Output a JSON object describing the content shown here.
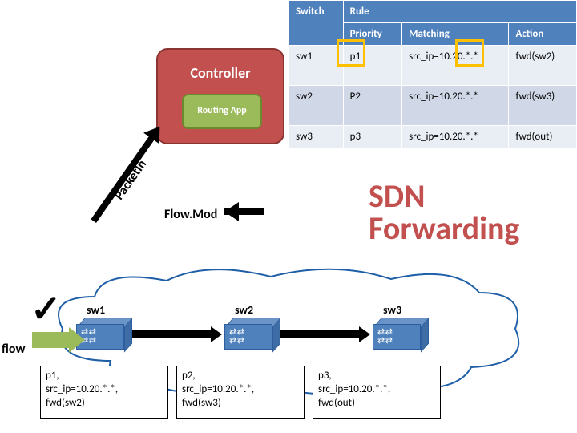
{
  "table": {
    "switch_header": "Switch",
    "rule_header": "Rule",
    "sub": {
      "priority": "Priority",
      "matching": "Matching",
      "action": "Action"
    },
    "rows": [
      {
        "switch": "sw1",
        "priority": "p1",
        "matching": "src_ip=10.20.*.*",
        "action": "fwd(sw2)"
      },
      {
        "switch": "sw2",
        "priority": "P2",
        "matching": "src_ip=10.20.*.*",
        "action": "fwd(sw3)"
      },
      {
        "switch": "sw3",
        "priority": "p3",
        "matching": "src_ip=10.20.*.*",
        "action": "fwd(out)"
      }
    ]
  },
  "controller": {
    "label": "Controller",
    "app": "Routing App"
  },
  "labels": {
    "sdn_title": "SDN Forwarding",
    "flowmod": "Flow.Mod",
    "packetin": "PacketIn",
    "flow": "flow",
    "checkmark": "✓"
  },
  "switches": {
    "sw1": "sw1",
    "sw2": "sw2",
    "sw3": "sw3"
  },
  "ruleboxes": {
    "rb1": "p1,\nsrc_ip=10.20.*.*,\nfwd(sw2)",
    "rb2": "p2,\nsrc_ip=10.20.*.*,\nfwd(sw3)",
    "rb3": "p3,\nsrc_ip=10.20.*.*,\nfwd(out)"
  }
}
